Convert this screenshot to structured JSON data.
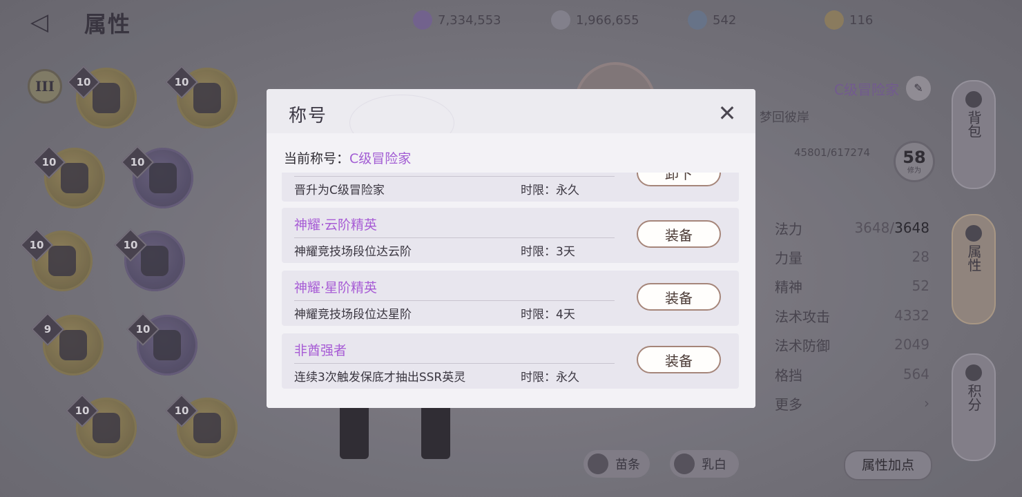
{
  "header": {
    "back_label": "◁",
    "title": "属性",
    "resources": [
      {
        "icon": "crystal-icon",
        "value": "7,334,553",
        "color": "#8a6fb0"
      },
      {
        "icon": "silver-coin-icon",
        "value": "1,966,655",
        "color": "#9a98a6"
      },
      {
        "icon": "blue-gem-icon",
        "value": "542",
        "color": "#6a88a8"
      },
      {
        "icon": "gold-medal-icon",
        "value": "116",
        "color": "#b09050"
      }
    ]
  },
  "equipment": {
    "tier_label": "III",
    "slots": [
      {
        "icon": "helmet-icon",
        "level": "10"
      },
      {
        "icon": "gauntlet-icon",
        "level": "10"
      },
      {
        "icon": "armor-icon",
        "level": "10"
      },
      {
        "icon": "necklace-icon",
        "level": "10"
      },
      {
        "icon": "pants-icon",
        "level": "10"
      },
      {
        "icon": "pendant-icon",
        "level": "10"
      },
      {
        "icon": "boots-icon",
        "level": "9"
      },
      {
        "icon": "ring-icon",
        "level": "10"
      },
      {
        "icon": "dagger-icon",
        "level": "10"
      },
      {
        "icon": "earring-icon",
        "level": "10"
      }
    ]
  },
  "profile": {
    "rank_title": "C级冒险家",
    "guild": "梦回彼岸",
    "exp": "45801/617274",
    "level": "58",
    "level_sub": "修为"
  },
  "stats": [
    {
      "label": "法力",
      "value_dim": "3648/",
      "value": "3648"
    },
    {
      "label": "力量",
      "value_dim": "",
      "value": "28"
    },
    {
      "label": "精神",
      "value_dim": "",
      "value": "52"
    },
    {
      "label": "法术攻击",
      "value_dim": "",
      "value": "4332"
    },
    {
      "label": "法术防御",
      "value_dim": "",
      "value": "2049"
    },
    {
      "label": "格挡",
      "value_dim": "",
      "value": "564"
    },
    {
      "label": "更多",
      "value_dim": "",
      "value": "›"
    }
  ],
  "side_tabs": [
    {
      "label": "背包",
      "icon": "backpack-icon"
    },
    {
      "label": "属性",
      "icon": "taiji-icon"
    },
    {
      "label": "积分",
      "icon": "points-icon"
    }
  ],
  "bottom": {
    "dye1": "苗条",
    "dye2": "乳白",
    "attr_points": "属性加点"
  },
  "modal": {
    "title": "称号",
    "current_label": "当前称号：",
    "current_value": "C级冒险家",
    "close_icon": "close-icon",
    "titles": [
      {
        "name": "",
        "desc": "晋升为C级冒险家",
        "limit": "时限：永久",
        "button": "卸下"
      },
      {
        "name": "神耀·云阶精英",
        "desc": "神耀竞技场段位达云阶",
        "limit": "时限：3天",
        "button": "装备"
      },
      {
        "name": "神耀·星阶精英",
        "desc": "神耀竞技场段位达星阶",
        "limit": "时限：4天",
        "button": "装备"
      },
      {
        "name": "非酋强者",
        "desc": "连续3次触发保底才抽出SSR英灵",
        "limit": "时限：永久",
        "button": "装备"
      }
    ]
  }
}
